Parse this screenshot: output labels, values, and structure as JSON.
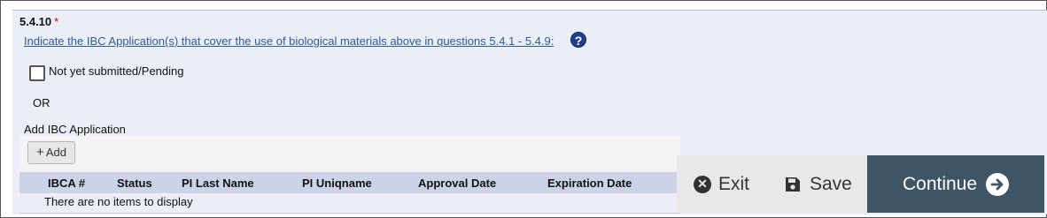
{
  "question": {
    "number": "5.4.10",
    "required_mark": "*",
    "prompt": "Indicate the IBC Application(s) that cover the use of biological materials above in questions 5.4.1 - 5.4.9:",
    "help_glyph": "?"
  },
  "pending_option": {
    "label": "Not yet submitted/Pending",
    "checked": false
  },
  "or_label": "OR",
  "ibc_grid": {
    "title": "Add IBC Application",
    "add_button_label": "Add",
    "columns": [
      "IBCA #",
      "Status",
      "PI Last Name",
      "PI Uniqname",
      "Approval Date",
      "Expiration Date"
    ],
    "rows": [],
    "empty_message": "There are no items to display"
  },
  "actions": {
    "exit_label": "Exit",
    "save_label": "Save",
    "continue_label": "Continue",
    "continue_color": "#3f5566"
  }
}
